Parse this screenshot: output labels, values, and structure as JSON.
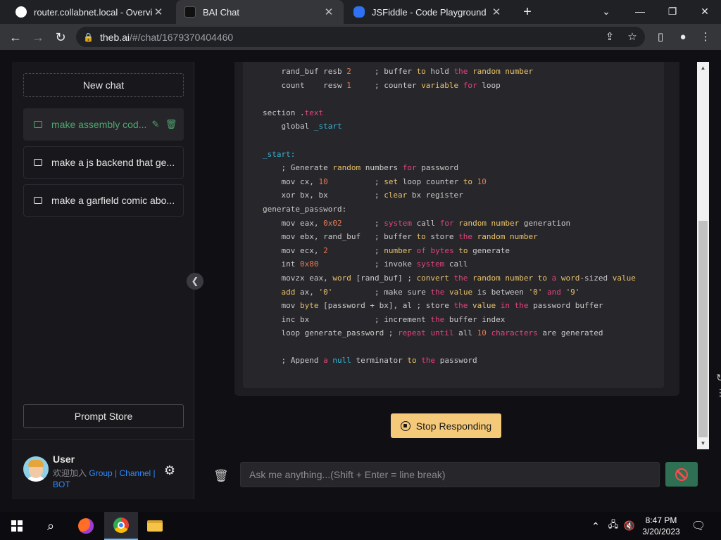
{
  "browser": {
    "tabs": [
      {
        "label": "router.collabnet.local - Overview",
        "icon": "router-favicon"
      },
      {
        "label": "BAI Chat",
        "icon": "bai-favicon"
      },
      {
        "label": "JSFiddle - Code Playground",
        "icon": "jsfiddle-favicon"
      }
    ],
    "new_tab": "+",
    "url_host": "theb.ai",
    "url_path": "/#/chat/1679370404460"
  },
  "sidebar": {
    "new_chat": "New chat",
    "chats": [
      {
        "label": "make assembly cod...",
        "active": true
      },
      {
        "label": "make a js backend that ge...",
        "active": false
      },
      {
        "label": "make a garfield comic abo...",
        "active": false
      }
    ],
    "prompt_store": "Prompt Store",
    "user": {
      "name": "User",
      "join_text": "欢迎加入",
      "group": "Group",
      "sep": " | ",
      "channel": "Channel",
      "bot": "BOT"
    }
  },
  "code": {
    "lines": [
      [
        {
          "t": "    rand_buf resb "
        },
        {
          "t": "2",
          "c": "num"
        },
        {
          "t": "     ; buffer "
        },
        {
          "t": "to",
          "c": "yel"
        },
        {
          "t": " hold "
        },
        {
          "t": "the",
          "c": "pink"
        },
        {
          "t": " "
        },
        {
          "t": "random number",
          "c": "yel"
        }
      ],
      [
        {
          "t": "    count    resw "
        },
        {
          "t": "1",
          "c": "num"
        },
        {
          "t": "     ; counter "
        },
        {
          "t": "variable",
          "c": "yel"
        },
        {
          "t": " "
        },
        {
          "t": "for",
          "c": "pink"
        },
        {
          "t": " loop"
        }
      ],
      [
        {
          "t": ""
        }
      ],
      [
        {
          "t": "section ."
        },
        {
          "t": "text",
          "c": "pink"
        }
      ],
      [
        {
          "t": "    global "
        },
        {
          "t": "_start",
          "c": "cyan"
        }
      ],
      [
        {
          "t": ""
        }
      ],
      [
        {
          "t": "_start:",
          "c": "cyan"
        }
      ],
      [
        {
          "t": "    ; Generate "
        },
        {
          "t": "random",
          "c": "yel"
        },
        {
          "t": " numbers "
        },
        {
          "t": "for",
          "c": "pink"
        },
        {
          "t": " password"
        }
      ],
      [
        {
          "t": "    mov cx, "
        },
        {
          "t": "10",
          "c": "num"
        },
        {
          "t": "          ; "
        },
        {
          "t": "set",
          "c": "yel"
        },
        {
          "t": " loop counter "
        },
        {
          "t": "to",
          "c": "yel"
        },
        {
          "t": " "
        },
        {
          "t": "10",
          "c": "num"
        }
      ],
      [
        {
          "t": "    xor bx, bx          ; "
        },
        {
          "t": "clear",
          "c": "yel"
        },
        {
          "t": " bx register"
        }
      ],
      [
        {
          "t": "generate_password:"
        }
      ],
      [
        {
          "t": "    mov eax, "
        },
        {
          "t": "0x02",
          "c": "num"
        },
        {
          "t": "       ; "
        },
        {
          "t": "system",
          "c": "pink"
        },
        {
          "t": " call "
        },
        {
          "t": "for",
          "c": "pink"
        },
        {
          "t": " "
        },
        {
          "t": "random number",
          "c": "yel"
        },
        {
          "t": " generation"
        }
      ],
      [
        {
          "t": "    mov ebx, rand_buf   ; buffer "
        },
        {
          "t": "to",
          "c": "yel"
        },
        {
          "t": " store "
        },
        {
          "t": "the",
          "c": "pink"
        },
        {
          "t": " "
        },
        {
          "t": "random number",
          "c": "yel"
        }
      ],
      [
        {
          "t": "    mov ecx, "
        },
        {
          "t": "2",
          "c": "num"
        },
        {
          "t": "          ; "
        },
        {
          "t": "number",
          "c": "yel"
        },
        {
          "t": " "
        },
        {
          "t": "of",
          "c": "pink"
        },
        {
          "t": " "
        },
        {
          "t": "bytes",
          "c": "pink"
        },
        {
          "t": " "
        },
        {
          "t": "to",
          "c": "yel"
        },
        {
          "t": " generate"
        }
      ],
      [
        {
          "t": "    int "
        },
        {
          "t": "0x80",
          "c": "num"
        },
        {
          "t": "            ; invoke "
        },
        {
          "t": "system",
          "c": "pink"
        },
        {
          "t": " call"
        }
      ],
      [
        {
          "t": "    movzx eax, "
        },
        {
          "t": "word",
          "c": "yel"
        },
        {
          "t": " [rand_buf] ; "
        },
        {
          "t": "convert",
          "c": "yel"
        },
        {
          "t": " "
        },
        {
          "t": "the",
          "c": "pink"
        },
        {
          "t": " "
        },
        {
          "t": "random number",
          "c": "yel"
        },
        {
          "t": " "
        },
        {
          "t": "to",
          "c": "yel"
        },
        {
          "t": " "
        },
        {
          "t": "a",
          "c": "pink"
        },
        {
          "t": " "
        },
        {
          "t": "word",
          "c": "yel"
        },
        {
          "t": "-sized "
        },
        {
          "t": "value",
          "c": "yel"
        }
      ],
      [
        {
          "t": "    "
        },
        {
          "t": "add",
          "c": "yel"
        },
        {
          "t": " ax, "
        },
        {
          "t": "'0'",
          "c": "str"
        },
        {
          "t": "         ; make sure "
        },
        {
          "t": "the",
          "c": "pink"
        },
        {
          "t": " "
        },
        {
          "t": "value",
          "c": "yel"
        },
        {
          "t": " is between "
        },
        {
          "t": "'0'",
          "c": "str"
        },
        {
          "t": " "
        },
        {
          "t": "and",
          "c": "pink"
        },
        {
          "t": " "
        },
        {
          "t": "'9'",
          "c": "str"
        }
      ],
      [
        {
          "t": "    mov "
        },
        {
          "t": "byte",
          "c": "yel"
        },
        {
          "t": " [password + bx], al ; store "
        },
        {
          "t": "the",
          "c": "pink"
        },
        {
          "t": " "
        },
        {
          "t": "value",
          "c": "yel"
        },
        {
          "t": " "
        },
        {
          "t": "in",
          "c": "pink"
        },
        {
          "t": " "
        },
        {
          "t": "the",
          "c": "pink"
        },
        {
          "t": " password buffer"
        }
      ],
      [
        {
          "t": "    inc bx              ; increment "
        },
        {
          "t": "the",
          "c": "pink"
        },
        {
          "t": " buffer index"
        }
      ],
      [
        {
          "t": "    loop generate_password ; "
        },
        {
          "t": "repeat",
          "c": "pink"
        },
        {
          "t": " "
        },
        {
          "t": "until",
          "c": "pink"
        },
        {
          "t": " all "
        },
        {
          "t": "10",
          "c": "num"
        },
        {
          "t": " "
        },
        {
          "t": "characters",
          "c": "pink"
        },
        {
          "t": " are generated"
        }
      ],
      [
        {
          "t": ""
        }
      ],
      [
        {
          "t": "    ; Append "
        },
        {
          "t": "a",
          "c": "pink"
        },
        {
          "t": " "
        },
        {
          "t": "null",
          "c": "cyan"
        },
        {
          "t": " terminator "
        },
        {
          "t": "to",
          "c": "yel"
        },
        {
          "t": " "
        },
        {
          "t": "the",
          "c": "pink"
        },
        {
          "t": " password"
        }
      ]
    ]
  },
  "actions": {
    "stop": "Stop Responding"
  },
  "input": {
    "placeholder": "Ask me anything...(Shift + Enter = line break)",
    "value": ""
  },
  "taskbar": {
    "time": "8:47 PM",
    "date": "3/20/2023"
  },
  "colors": {
    "accent_green": "#4fa56e",
    "stop_button": "#f5c97a",
    "send_button": "#2f6f53",
    "link_blue": "#2f88ff"
  }
}
